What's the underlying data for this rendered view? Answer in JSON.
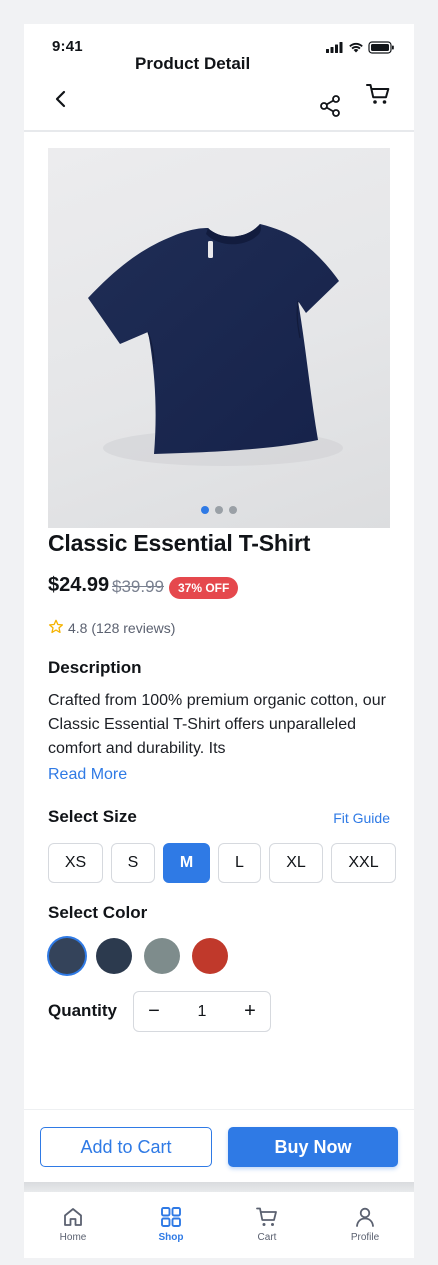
{
  "status_bar": {
    "time": "9:41"
  },
  "header": {
    "title": "Product Detail"
  },
  "product": {
    "title": "Classic Essential T-Shirt",
    "price": "$24.99",
    "original_price": "$39.99",
    "discount": "37% OFF",
    "rating_text": "4.8 (128 reviews)",
    "image_alt": "Navy blue t-shirt",
    "carousel": {
      "count": 3,
      "active_index": 0
    }
  },
  "description": {
    "heading": "Description",
    "text": "Crafted from 100% premium organic cotton, our Classic Essential T-Shirt offers unparalleled comfort and durability. Its",
    "read_more": "Read More"
  },
  "size": {
    "heading": "Select Size",
    "fit_guide": "Fit Guide",
    "options": [
      "XS",
      "S",
      "M",
      "L",
      "XL",
      "XXL"
    ],
    "selected": "M"
  },
  "color": {
    "heading": "Select Color",
    "swatches": [
      "#34435a",
      "#2c3a4e",
      "#7e8c8c",
      "#c0392b"
    ],
    "selected_index": 0
  },
  "quantity": {
    "label": "Quantity",
    "value": "1",
    "minus": "−",
    "plus": "+"
  },
  "actions": {
    "add_to_cart": "Add to Cart",
    "buy_now": "Buy Now"
  },
  "tabs": [
    {
      "label": "Home",
      "icon": "home-icon",
      "active": false
    },
    {
      "label": "Shop",
      "icon": "grid-icon",
      "active": true
    },
    {
      "label": "Cart",
      "icon": "cart-icon",
      "active": false
    },
    {
      "label": "Profile",
      "icon": "user-icon",
      "active": false
    }
  ],
  "colors": {
    "accent": "#2f7ae5",
    "badge": "#e5484d",
    "star": "#f5b301"
  }
}
